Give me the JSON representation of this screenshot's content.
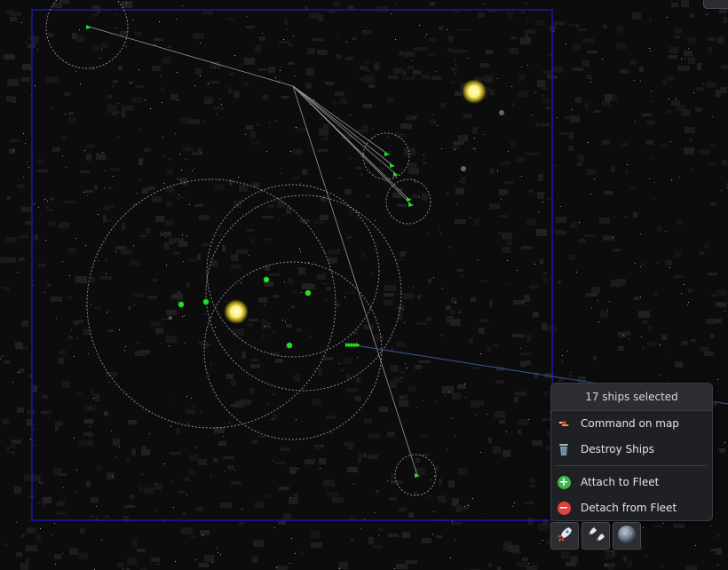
{
  "context_menu": {
    "header": "17 ships selected",
    "items": [
      {
        "label": "Command on map",
        "icon": "command-map-icon"
      },
      {
        "label": "Destroy Ships",
        "icon": "trash-icon"
      },
      {
        "label": "Attach to Fleet",
        "icon": "plus-circle-icon",
        "color": "#3fb34f"
      },
      {
        "label": "Detach from Fleet",
        "icon": "minus-circle-icon",
        "color": "#e0443e"
      }
    ]
  },
  "toolbar": {
    "buttons": [
      {
        "icon": "rocket-icon"
      },
      {
        "icon": "ships-icon"
      },
      {
        "icon": "planet-icon"
      }
    ]
  },
  "colors": {
    "selection_box": "#1a1aa8",
    "ship": "#22e022",
    "star": "#fff07a",
    "range_circle": "#cccccc",
    "path_line": "#9a9a9a"
  }
}
